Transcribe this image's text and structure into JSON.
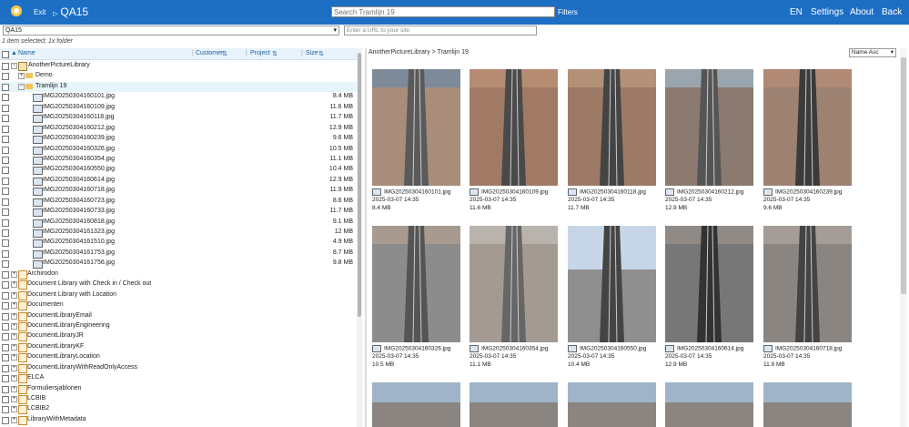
{
  "header": {
    "exit_label": "Exit",
    "app_name": "QA15",
    "search_placeholder": "Search Tramlijn 19",
    "filters_label": "Filters",
    "nav": [
      "EN",
      "Settings",
      "About",
      "Back"
    ]
  },
  "site_select": {
    "value": "QA15"
  },
  "url_input": {
    "placeholder": "Enter a URL to your site"
  },
  "status_line": "1  item  selected;  1x folder",
  "columns": {
    "name": "Name",
    "customer": "Customer",
    "project": "Project",
    "size": "Size"
  },
  "tree": {
    "root": "AnotherPictureLibrary",
    "demo": "Demo",
    "tram": "Tramlijn 19",
    "files": [
      {
        "name": "IMG20250304160101.jpg",
        "size": "8.4 MB"
      },
      {
        "name": "IMG20250304160109.jpg",
        "size": "11.6 MB"
      },
      {
        "name": "IMG20250304160118.jpg",
        "size": "11.7 MB"
      },
      {
        "name": "IMG20250304160212.jpg",
        "size": "12.9 MB"
      },
      {
        "name": "IMG20250304160239.jpg",
        "size": "9.6 MB"
      },
      {
        "name": "IMG20250304160326.jpg",
        "size": "10.5 MB"
      },
      {
        "name": "IMG20250304160354.jpg",
        "size": "11.1 MB"
      },
      {
        "name": "IMG20250304160550.jpg",
        "size": "10.4 MB"
      },
      {
        "name": "IMG20250304160614.jpg",
        "size": "12.9 MB"
      },
      {
        "name": "IMG20250304160718.jpg",
        "size": "11.9 MB"
      },
      {
        "name": "IMG20250304160723.jpg",
        "size": "8.6 MB"
      },
      {
        "name": "IMG20250304160733.jpg",
        "size": "11.7 MB"
      },
      {
        "name": "IMG20250304160818.jpg",
        "size": "9.1 MB"
      },
      {
        "name": "IMG20250304161323.jpg",
        "size": "12 MB"
      },
      {
        "name": "IMG20250304161510.jpg",
        "size": "4.9 MB"
      },
      {
        "name": "IMG20250304161753.jpg",
        "size": "8.7 MB"
      },
      {
        "name": "IMG20250304161756.jpg",
        "size": "9.8 MB"
      }
    ],
    "libraries": [
      "Archirodon",
      "Document Library with Check in / Check out",
      "Document Library with Location",
      "Documenten",
      "DocumentLibraryEmail",
      "DocumentLibraryEngineering",
      "DocumentLibraryJR",
      "DocumentLibraryKF",
      "DocumentLibraryLocation",
      "DocumentLibraryWithReadOnlyAccess",
      "ELCA",
      "Formuliersjablonen",
      "LCBIB",
      "LCBIB2",
      "LibraryWithMetadata"
    ]
  },
  "gallery": {
    "breadcrumb": "AnotherPictureLibrary  >  Tramlijn 19",
    "sort_value": "Name Asc",
    "items": [
      {
        "name": "IMG20250304160101.jpg",
        "date": "2025-03-07 14:35",
        "size": "8.4 MB"
      },
      {
        "name": "IMG20250304160109.jpg",
        "date": "2025-03-07 14:35",
        "size": "11.6 MB"
      },
      {
        "name": "IMG20250304160118.jpg",
        "date": "2025-03-07 14:35",
        "size": "11.7 MB"
      },
      {
        "name": "IMG20250304160212.jpg",
        "date": "2025-03-07 14:35",
        "size": "12.9 MB"
      },
      {
        "name": "IMG20250304160239.jpg",
        "date": "2025-03-07 14:35",
        "size": "9.6 MB"
      },
      {
        "name": "IMG20250304160326.jpg",
        "date": "2025-03-07 14:35",
        "size": "10.5 MB"
      },
      {
        "name": "IMG20250304160354.jpg",
        "date": "2025-03-07 14:35",
        "size": "11.1 MB"
      },
      {
        "name": "IMG20250304160550.jpg",
        "date": "2025-03-07 14:35",
        "size": "10.4 MB"
      },
      {
        "name": "IMG20250304160614.jpg",
        "date": "2025-03-07 14:35",
        "size": "12.9 MB"
      },
      {
        "name": "IMG20250304160718.jpg",
        "date": "2025-03-07 14:35",
        "size": "11.9 MB"
      }
    ]
  }
}
